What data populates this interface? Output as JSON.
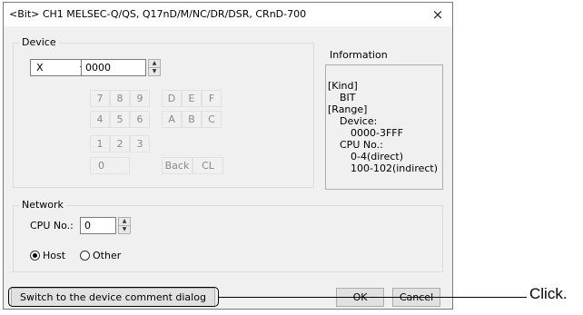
{
  "window": {
    "title": "<Bit> CH1 MELSEC-Q/QS, Q17nD/M/NC/DR/DSR, CRnD-700",
    "close_glyph": "×"
  },
  "device": {
    "group_label": "Device",
    "type_value": "X",
    "number_value": "0000",
    "keypad": [
      "7",
      "8",
      "9",
      "D",
      "E",
      "F",
      "4",
      "5",
      "6",
      "A",
      "B",
      "C",
      "1",
      "2",
      "3",
      "0",
      "Back",
      "CL"
    ]
  },
  "information": {
    "label": "Information",
    "lines": [
      "[Kind]",
      "BIT",
      "[Range]",
      "Device:",
      "0000-3FFF",
      "CPU No.:",
      "0-4(direct)",
      "100-102(indirect)"
    ]
  },
  "network": {
    "group_label": "Network",
    "cpu_label": "CPU No.:",
    "cpu_value": "0",
    "host_label": "Host",
    "other_label": "Other",
    "selected": "Host"
  },
  "buttons": {
    "switch_comment": "Switch to the device comment dialog",
    "ok": "OK",
    "cancel": "Cancel"
  },
  "annotation": {
    "callout": "Click."
  }
}
